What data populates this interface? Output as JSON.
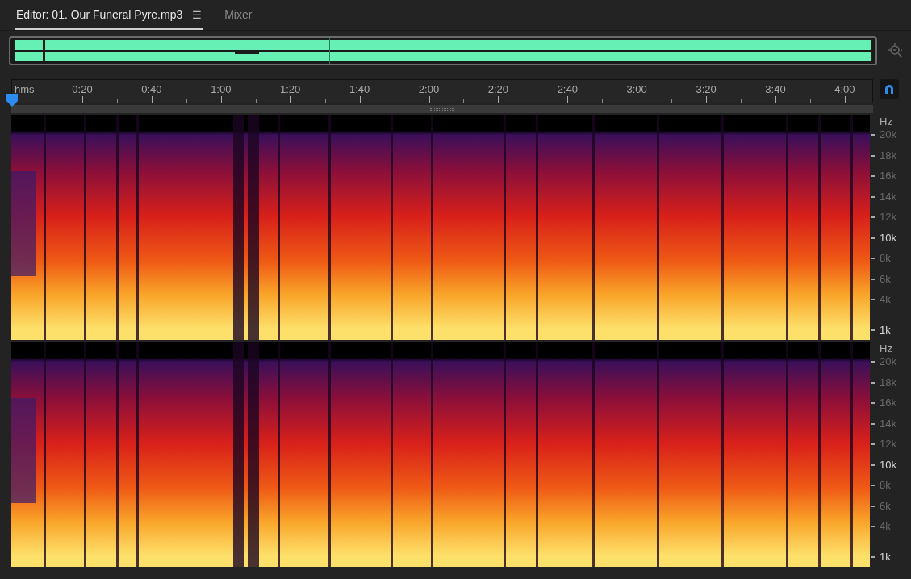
{
  "tabs": [
    {
      "label": "Editor: 01. Our Funeral Pyre.mp3",
      "selected": true,
      "menu_icon": "☰"
    },
    {
      "label": "Mixer",
      "selected": false
    }
  ],
  "ruler": {
    "unit": "hms",
    "labels": [
      "0:20",
      "0:40",
      "1:00",
      "1:20",
      "1:40",
      "2:00",
      "2:20",
      "2:40",
      "3:00",
      "3:20",
      "3:40",
      "4:00"
    ]
  },
  "channels": [
    {
      "axis": [
        {
          "label": "Hz",
          "major": false
        },
        {
          "label": "20k",
          "major": false
        },
        {
          "label": "18k",
          "major": false
        },
        {
          "label": "16k",
          "major": false
        },
        {
          "label": "14k",
          "major": false
        },
        {
          "label": "12k",
          "major": false
        },
        {
          "label": "10k",
          "major": true
        },
        {
          "label": "8k",
          "major": false
        },
        {
          "label": "6k",
          "major": false
        },
        {
          "label": "4k",
          "major": false
        },
        {
          "label": "1k",
          "major": true
        }
      ]
    },
    {
      "axis": [
        {
          "label": "Hz",
          "major": false
        },
        {
          "label": "20k",
          "major": false
        },
        {
          "label": "18k",
          "major": false
        },
        {
          "label": "16k",
          "major": false
        },
        {
          "label": "14k",
          "major": false
        },
        {
          "label": "12k",
          "major": false
        },
        {
          "label": "10k",
          "major": true
        },
        {
          "label": "8k",
          "major": false
        },
        {
          "label": "6k",
          "major": false
        },
        {
          "label": "4k",
          "major": false
        },
        {
          "label": "1k",
          "major": true
        }
      ]
    }
  ]
}
